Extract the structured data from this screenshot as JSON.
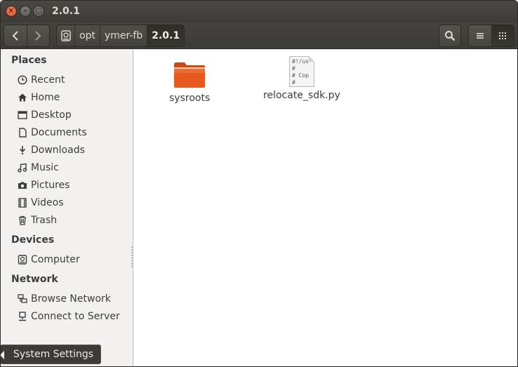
{
  "window": {
    "title": "2.0.1",
    "close_glyph": "×",
    "min_glyph": "–",
    "max_glyph": "□"
  },
  "toolbar": {
    "back_icon": "chevron-left-icon",
    "forward_icon": "chevron-right-icon",
    "breadcrumbs": [
      "opt",
      "ymer-fb",
      "2.0.1"
    ],
    "search_icon": "search-icon",
    "list_view_icon": "list-view-icon",
    "grid_view_icon": "grid-view-icon"
  },
  "sidebar": {
    "places_heading": "Places",
    "places": [
      {
        "label": "Recent",
        "icon": "clock-icon"
      },
      {
        "label": "Home",
        "icon": "home-icon"
      },
      {
        "label": "Desktop",
        "icon": "desktop-icon"
      },
      {
        "label": "Documents",
        "icon": "documents-icon"
      },
      {
        "label": "Downloads",
        "icon": "download-icon"
      },
      {
        "label": "Music",
        "icon": "music-icon"
      },
      {
        "label": "Pictures",
        "icon": "camera-icon"
      },
      {
        "label": "Videos",
        "icon": "film-icon"
      },
      {
        "label": "Trash",
        "icon": "trash-icon"
      }
    ],
    "devices_heading": "Devices",
    "devices": [
      {
        "label": "Computer",
        "icon": "drive-icon"
      }
    ],
    "network_heading": "Network",
    "network": [
      {
        "label": "Browse Network",
        "icon": "network-icon"
      },
      {
        "label": "Connect to Server",
        "icon": "server-icon"
      }
    ]
  },
  "tooltip": {
    "label": "System Settings"
  },
  "files": [
    {
      "name": "sysroots",
      "type": "folder"
    },
    {
      "name": "relocate_sdk.py",
      "type": "script",
      "preview": [
        "#!/us",
        "#",
        "# Cop",
        "#"
      ]
    }
  ],
  "colors": {
    "folder": "#e8571e",
    "titlebar": "#3c3b37",
    "close_button": "#df4a16"
  }
}
